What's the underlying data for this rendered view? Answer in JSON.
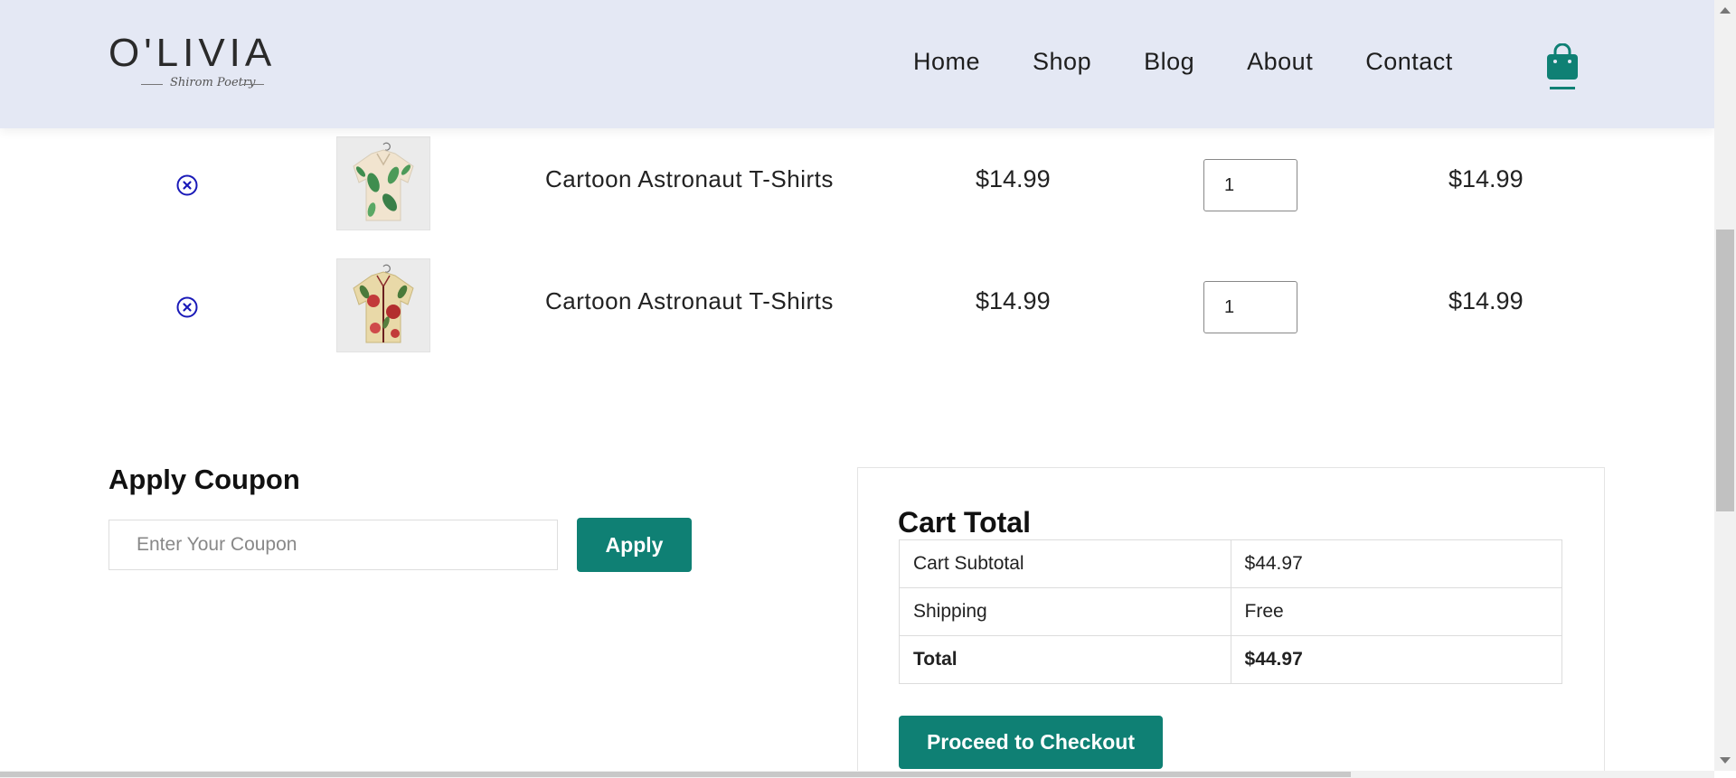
{
  "brand": {
    "name": "O'LIVIA",
    "tagline": "Shirom Poetry"
  },
  "nav": {
    "items": [
      "Home",
      "Shop",
      "Blog",
      "About",
      "Contact"
    ]
  },
  "cart_items": [
    {
      "name": "Cartoon Astronaut T-Shirts",
      "price": "$14.99",
      "quantity": "1",
      "subtotal": "$14.99"
    },
    {
      "name": "Cartoon Astronaut T-Shirts",
      "price": "$14.99",
      "quantity": "1",
      "subtotal": "$14.99"
    }
  ],
  "coupon": {
    "title": "Apply Coupon",
    "placeholder": "Enter Your Coupon",
    "button": "Apply"
  },
  "cart_total": {
    "title": "Cart Total",
    "rows": [
      {
        "label": "Cart Subtotal",
        "value": "$44.97"
      },
      {
        "label": "Shipping",
        "value": "Free"
      },
      {
        "label": "Total",
        "value": "$44.97"
      }
    ],
    "checkout_button": "Proceed to Checkout"
  },
  "colors": {
    "header_bg": "#e4e8f4",
    "accent": "#0f8074",
    "remove_icon": "#1a1ab8"
  },
  "icons": {
    "remove": "circle-x-icon",
    "cart": "shopping-bag-icon"
  }
}
